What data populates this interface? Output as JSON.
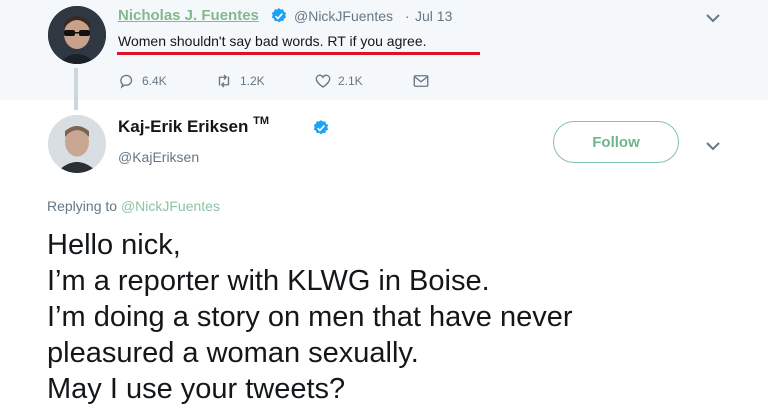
{
  "top_tweet": {
    "author_name": "Nicholas J. Fuentes",
    "handle": "@NickJFuentes",
    "separator": "·",
    "date": "Jul 13",
    "text": "Women shouldn't say bad words. RT if you agree.",
    "reply_count": "6.4K",
    "retweet_count": "1.2K",
    "like_count": "2.1K"
  },
  "reply_tweet": {
    "author_name": "Kaj-Erik Eriksen",
    "trademark": "TM",
    "handle": "@KajEriksen",
    "follow_label": "Follow",
    "replying_prefix": "Replying to",
    "replying_handle": "@NickJFuentes",
    "lines": [
      "Hello nick,",
      "I’m a reporter with KLWG in Boise.",
      "I’m doing a story on men that have never",
      "pleasured a woman sexually.",
      "May I use your tweets?"
    ]
  },
  "colors": {
    "link_green": "#82b98f",
    "verified_blue": "#1da1f2",
    "highlight_red": "#e0102a",
    "muted_gray": "#657786"
  },
  "icons": [
    "verified-badge-icon",
    "chevron-down-icon",
    "reply-icon",
    "retweet-icon",
    "like-icon",
    "message-icon"
  ]
}
